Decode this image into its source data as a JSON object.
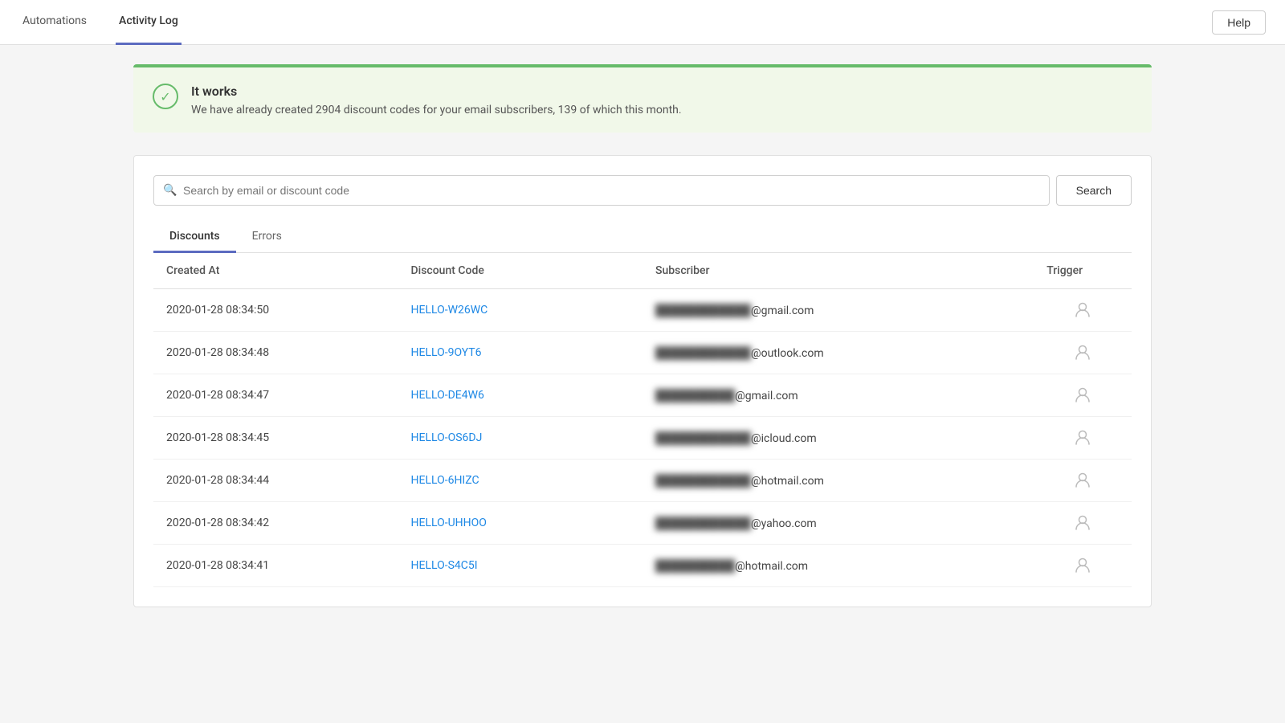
{
  "nav": {
    "items": [
      {
        "id": "automations",
        "label": "Automations",
        "active": false
      },
      {
        "id": "activity-log",
        "label": "Activity Log",
        "active": true
      }
    ],
    "help_button": "Help"
  },
  "banner": {
    "title": "It works",
    "message": "We have already created 2904 discount codes for your email subscribers, 139 of which this month."
  },
  "search": {
    "placeholder": "Search by email or discount code",
    "button_label": "Search"
  },
  "tabs": [
    {
      "id": "discounts",
      "label": "Discounts",
      "active": true
    },
    {
      "id": "errors",
      "label": "Errors",
      "active": false
    }
  ],
  "table": {
    "columns": [
      {
        "id": "created_at",
        "label": "Created At"
      },
      {
        "id": "discount_code",
        "label": "Discount Code"
      },
      {
        "id": "subscriber",
        "label": "Subscriber"
      },
      {
        "id": "trigger",
        "label": "Trigger"
      }
    ],
    "rows": [
      {
        "created_at": "2020-01-28 08:34:50",
        "discount_code": "HELLO-W26WC",
        "subscriber_prefix": "████████████",
        "subscriber_domain": "@gmail.com"
      },
      {
        "created_at": "2020-01-28 08:34:48",
        "discount_code": "HELLO-9OYT6",
        "subscriber_prefix": "████████████",
        "subscriber_domain": "@outlook.com"
      },
      {
        "created_at": "2020-01-28 08:34:47",
        "discount_code": "HELLO-DE4W6",
        "subscriber_prefix": "██████████",
        "subscriber_domain": "@gmail.com"
      },
      {
        "created_at": "2020-01-28 08:34:45",
        "discount_code": "HELLO-OS6DJ",
        "subscriber_prefix": "████████████",
        "subscriber_domain": "@icloud.com"
      },
      {
        "created_at": "2020-01-28 08:34:44",
        "discount_code": "HELLO-6HIZC",
        "subscriber_prefix": "████████████",
        "subscriber_domain": "@hotmail.com"
      },
      {
        "created_at": "2020-01-28 08:34:42",
        "discount_code": "HELLO-UHHOO",
        "subscriber_prefix": "████████████",
        "subscriber_domain": "@yahoo.com"
      },
      {
        "created_at": "2020-01-28 08:34:41",
        "discount_code": "HELLO-S4C5I",
        "subscriber_prefix": "██████████",
        "subscriber_domain": "@hotmail.com"
      }
    ]
  },
  "colors": {
    "active_tab_underline": "#5c6bc0",
    "link_blue": "#1e88e5",
    "success_green": "#66bb6a",
    "success_bg": "#f1f8e9"
  }
}
